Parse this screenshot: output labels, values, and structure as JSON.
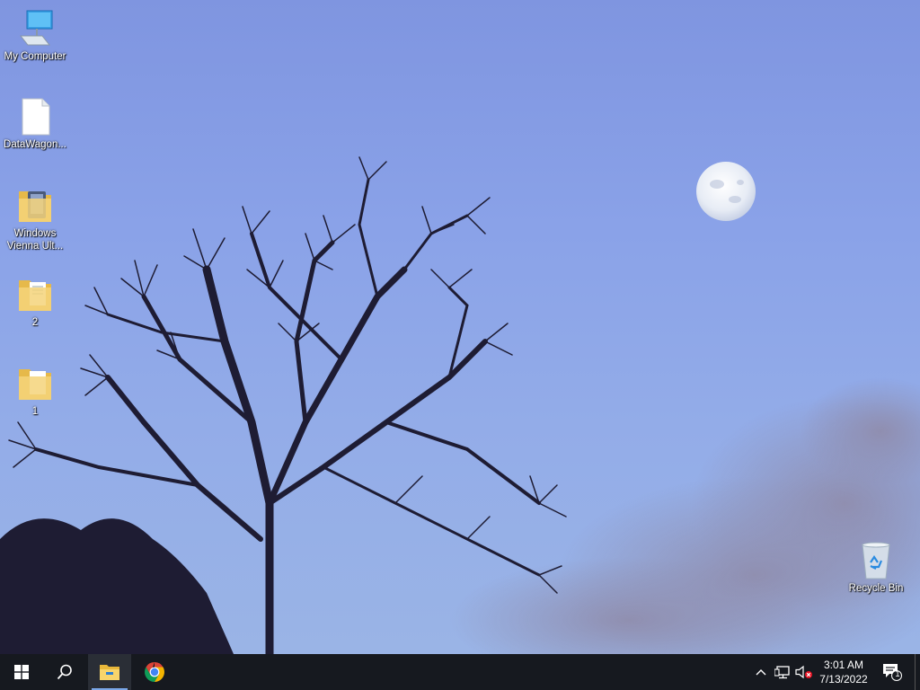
{
  "desktop": {
    "icons": [
      {
        "label": "My Computer",
        "icon": "computer-icon"
      },
      {
        "label": "DataWagon...",
        "icon": "file-icon"
      },
      {
        "label": "Windows Vienna Ult...",
        "icon": "folder-icon"
      },
      {
        "label": "2",
        "icon": "folder-icon"
      },
      {
        "label": "1",
        "icon": "folder-icon"
      },
      {
        "label": "Recycle Bin",
        "icon": "recycle-bin-icon"
      }
    ]
  },
  "taskbar": {
    "start_icon": "windows-logo-icon",
    "search_icon": "search-icon",
    "pinned": [
      {
        "name": "File Explorer",
        "icon": "file-explorer-icon",
        "active": true
      },
      {
        "name": "Google Chrome",
        "icon": "chrome-icon",
        "active": false
      }
    ],
    "tray": {
      "chevron_icon": "chevron-up-icon",
      "network_icon": "network-icon",
      "volume_icon": "volume-muted-icon",
      "time": "3:01 AM",
      "date": "7/13/2022",
      "notifications_count": "1"
    }
  },
  "colors": {
    "taskbar": "#16191f",
    "sky": "#8aa2e8",
    "accent": "#7aa7e8"
  }
}
